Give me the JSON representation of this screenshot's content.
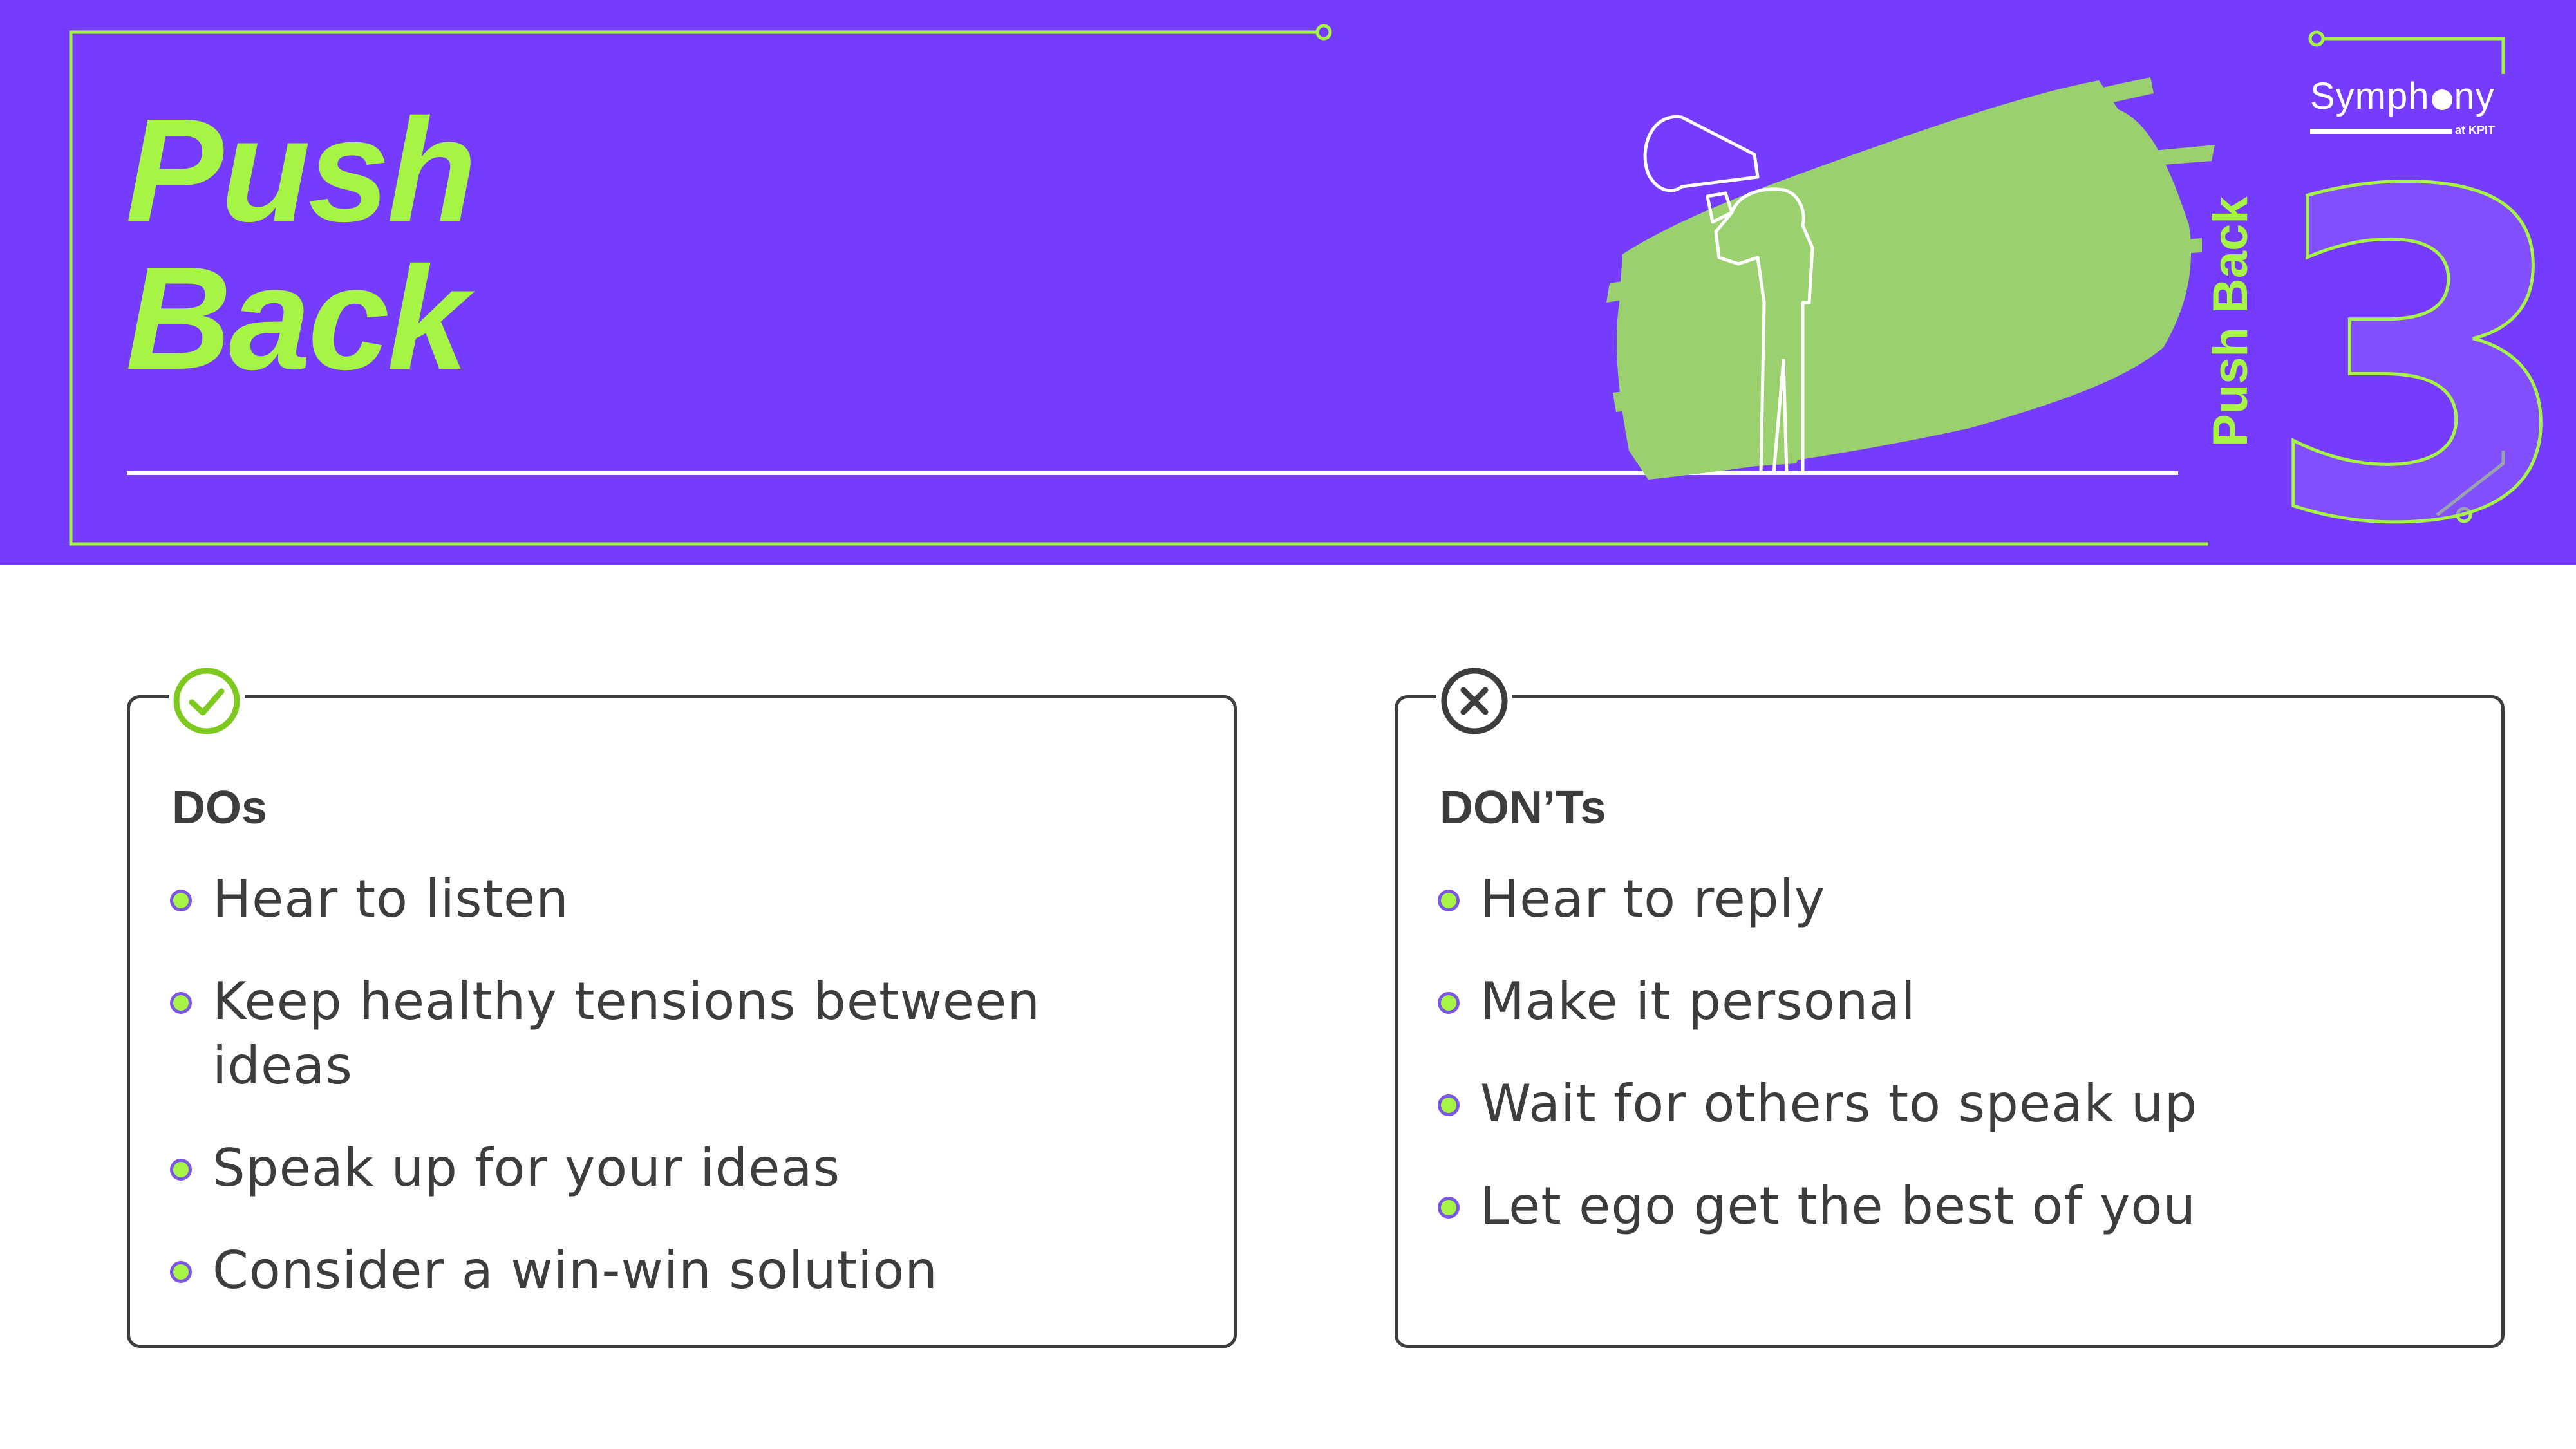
{
  "banner": {
    "title_line1": "Push",
    "title_line2": "Back",
    "side_label": "Push Back",
    "number": "3",
    "logo": {
      "name_start": "Symph",
      "name_end": "ny",
      "sub": "at KPIT"
    },
    "illustration": "person-with-megaphone",
    "colors": {
      "background": "#763cfe",
      "accent": "#a6f544",
      "brush": "#9bd06f"
    }
  },
  "dos": {
    "icon": "check-circle-icon",
    "heading": "DOs",
    "items": [
      "Hear to listen",
      "Keep healthy tensions between ideas",
      "Speak up for your ideas",
      "Consider a win-win solution"
    ]
  },
  "donts": {
    "icon": "x-circle-icon",
    "heading": "DON’Ts",
    "items": [
      "Hear to reply",
      "Make it personal",
      "Wait for others to speak up",
      "Let ego get the best of you"
    ]
  },
  "colors": {
    "text": "#3d3d3d",
    "bullet_fill": "#a6f544",
    "bullet_ring": "#7b57e4"
  }
}
